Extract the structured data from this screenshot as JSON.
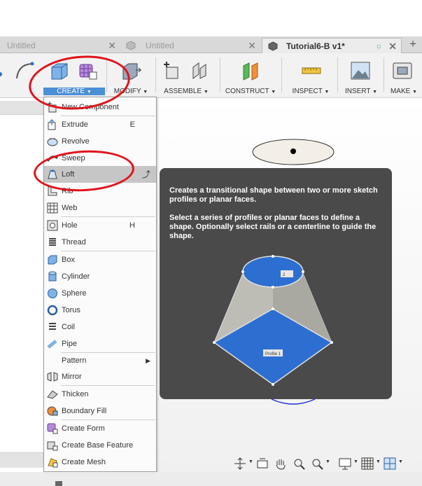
{
  "tabs": [
    {
      "label": "Untitled"
    },
    {
      "label": "Untitled"
    },
    {
      "label": "Tutorial6-B v1*",
      "active": true
    }
  ],
  "toolbar": {
    "groups": [
      {
        "label": "CREATE",
        "selected": true
      },
      {
        "label": "MODIFY"
      },
      {
        "label": "ASSEMBLE"
      },
      {
        "label": "CONSTRUCT"
      },
      {
        "label": "INSPECT"
      },
      {
        "label": "INSERT"
      },
      {
        "label": "MAKE"
      }
    ]
  },
  "create_menu": {
    "items": [
      {
        "label": "New Component",
        "icon": "new-component-icon"
      },
      {
        "label": "Extrude",
        "shortcut": "E",
        "icon": "extrude-icon"
      },
      {
        "label": "Revolve",
        "icon": "revolve-icon"
      },
      {
        "label": "Sweep",
        "icon": "sweep-icon"
      },
      {
        "label": "Loft",
        "icon": "loft-icon",
        "highlighted": true
      },
      {
        "label": "Rib",
        "icon": "rib-icon"
      },
      {
        "label": "Web",
        "icon": "web-icon"
      },
      {
        "label": "Hole",
        "shortcut": "H",
        "icon": "hole-icon"
      },
      {
        "label": "Thread",
        "icon": "thread-icon"
      },
      {
        "label": "Box",
        "icon": "box-icon"
      },
      {
        "label": "Cylinder",
        "icon": "cylinder-icon"
      },
      {
        "label": "Sphere",
        "icon": "sphere-icon"
      },
      {
        "label": "Torus",
        "icon": "torus-icon"
      },
      {
        "label": "Coil",
        "icon": "coil-icon"
      },
      {
        "label": "Pipe",
        "icon": "pipe-icon"
      },
      {
        "label": "Pattern",
        "icon": "",
        "submenu": true
      },
      {
        "label": "Mirror",
        "icon": "mirror-icon"
      },
      {
        "label": "Thicken",
        "icon": "thicken-icon"
      },
      {
        "label": "Boundary Fill",
        "icon": "boundary-fill-icon"
      },
      {
        "label": "Create Form",
        "icon": "create-form-icon"
      },
      {
        "label": "Create Base Feature",
        "icon": "base-feature-icon"
      },
      {
        "label": "Create Mesh",
        "icon": "create-mesh-icon"
      }
    ]
  },
  "tooltip": {
    "line1": "Creates a transitional shape between two or more sketch profiles or planar faces.",
    "line2": "Select a series of profiles or planar faces to define a shape. Optionally select rails or a centerline to guide the shape.",
    "profile_tag": "Profile 1",
    "profile_tag2": "2"
  },
  "colors": {
    "accent": "#4b8fd6",
    "annotation": "#e0131b",
    "tooltip_bg": "#4a4a4a",
    "profile_blue": "#2d6fd0"
  }
}
